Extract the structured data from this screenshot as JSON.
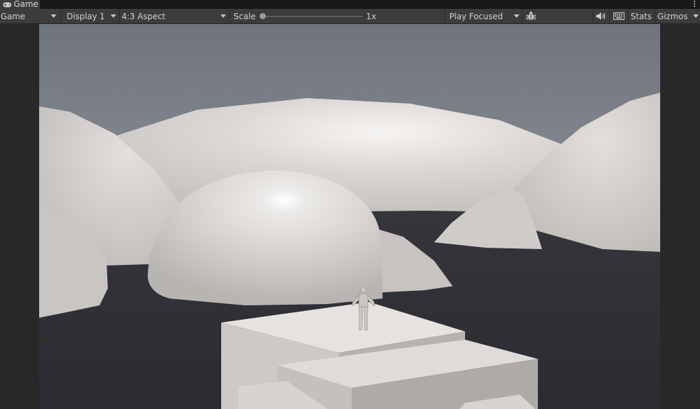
{
  "tab": {
    "title": "Game",
    "icon": "gamepad-icon"
  },
  "toolbar": {
    "view_mode": "Game",
    "display": "Display 1",
    "aspect": "4:3 Aspect",
    "scale_label": "Scale",
    "scale_value": "1x",
    "play_mode": "Play Focused",
    "stats_label": "Stats",
    "gizmos_label": "Gizmos"
  },
  "colors": {
    "toolbar_bg": "#3c3c3c",
    "tab_strip_bg": "#191919",
    "editor_bg": "#282828",
    "sky_top": "#6f747c",
    "ground": "#2d2f34",
    "geometry": "#d8d4d0"
  }
}
